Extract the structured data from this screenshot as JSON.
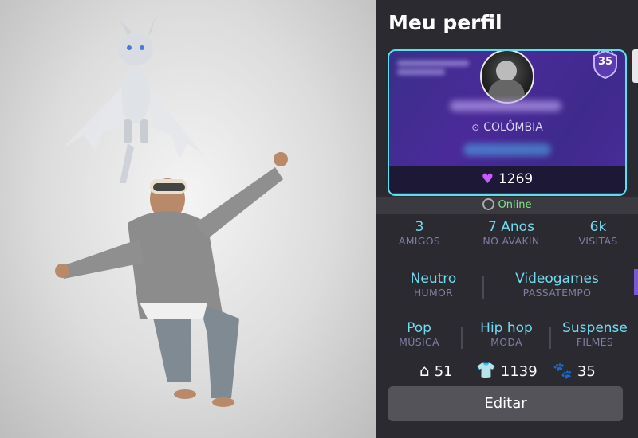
{
  "profile": {
    "title": "Meu perfil",
    "level": "35",
    "location": "COLÔMBIA",
    "likes": "1269",
    "online": "Online"
  },
  "stats": [
    {
      "value": "3",
      "label": "AMIGOS"
    },
    {
      "value": "7 Anos",
      "label": "NO AVAKIN"
    },
    {
      "value": "6k",
      "label": "VISITAS"
    }
  ],
  "traits": [
    {
      "value": "Neutro",
      "label": "HUMOR"
    },
    {
      "value": "Videogames",
      "label": "PASSATEMPO"
    }
  ],
  "likes_row": [
    {
      "value": "Pop",
      "label": "MÚSICA"
    },
    {
      "value": "Hip hop",
      "label": "MODA"
    },
    {
      "value": "Suspense",
      "label": "FILMES"
    }
  ],
  "counts": {
    "homes": "51",
    "outfits": "1139",
    "pets": "35"
  },
  "edit_label": "Editar",
  "colors": {
    "accent": "#6fdcf0",
    "online": "#7fe48a",
    "heart": "#c85bff"
  }
}
